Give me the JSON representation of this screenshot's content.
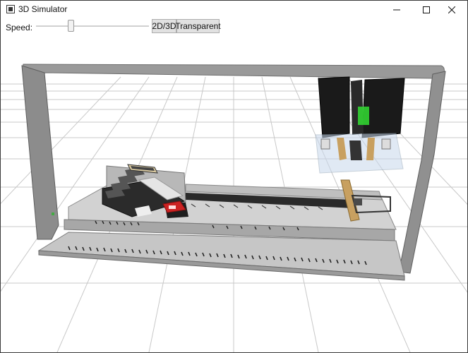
{
  "window": {
    "title": "3D Simulator",
    "controls": {
      "minimize": "minimize-icon",
      "maximize": "maximize-icon",
      "close": "close-icon"
    }
  },
  "toolbar": {
    "speed_label": "Speed:",
    "speed_level": 0.3,
    "view_toggle_label": "2D/3D",
    "transparent_label": "Transparent"
  },
  "scene": {
    "background": "#ffffff",
    "grid_color": "#c8c8c8",
    "frame_color": "#8f8f8f",
    "deck_color": "#bdbdbd",
    "accent_red": "#cc2222",
    "accent_green": "#33dd33",
    "gripper_color": "#c8a060"
  }
}
